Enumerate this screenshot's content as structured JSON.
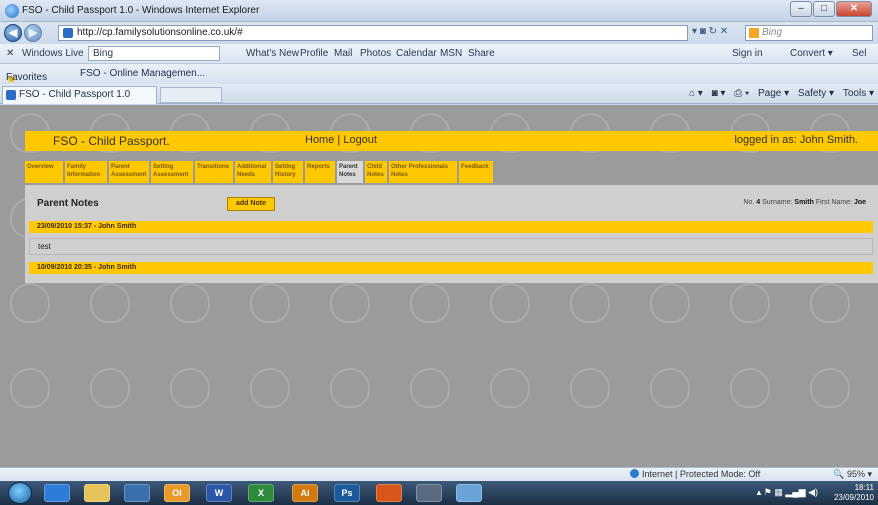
{
  "window": {
    "title": "FSO - Child Passport 1.0 - Windows Internet Explorer",
    "minimize": "–",
    "maximize": "□",
    "close": "✕"
  },
  "address": {
    "url": "http://cp.familysolutionsonline.co.uk/#",
    "search_placeholder": "Bing",
    "icons": "▾ ◙ ↻ ✕"
  },
  "live_toolbar": {
    "close": "✕",
    "brand": "Windows Live",
    "search_value": "Bing",
    "links": [
      "What's New",
      "Profile",
      "Mail",
      "Photos",
      "Calendar",
      "MSN",
      "Share"
    ],
    "sign_in": "Sign in",
    "convert": "Convert ▾",
    "select": "Sel"
  },
  "favorites": {
    "label": "Favorites",
    "item": "FSO - Online Managemen..."
  },
  "browser_tab": {
    "label": "FSO - Child Passport 1.0"
  },
  "command_bar": {
    "page": "Page ▾",
    "safety": "Safety ▾",
    "tools": "Tools ▾"
  },
  "app": {
    "brand": "FSO - Child Passport.",
    "home": "Home",
    "separator": "|",
    "logout": "Logout",
    "logged_in": "logged in as: John Smith.",
    "tabs": [
      {
        "label": "Overview"
      },
      {
        "label": "Family Information"
      },
      {
        "label": "Parent Assessment"
      },
      {
        "label": "Setting Assessment"
      },
      {
        "label": "Transitions"
      },
      {
        "label": "Additional Needs"
      },
      {
        "label": "Setting History"
      },
      {
        "label": "Reports"
      },
      {
        "label": "Parent Notes"
      },
      {
        "label": "Child Notes"
      },
      {
        "label": "Other Professionals Notes"
      },
      {
        "label": "Feedback"
      }
    ],
    "panel_title": "Parent Notes",
    "add_note": "add Note",
    "no_label": "No.",
    "no_value": "4",
    "surname_label": "Surname:",
    "surname_value": "Smith",
    "firstname_label": "First Name:",
    "firstname_value": "Joe",
    "notes": [
      {
        "header": "23/09/2010 15:37 - John Smith",
        "body": "test"
      },
      {
        "header": "10/09/2010 20:35 - John Smith",
        "body": ""
      }
    ]
  },
  "status": {
    "zone": "Internet | Protected Mode: Off",
    "zoom": "95%"
  },
  "taskbar": {
    "time": "18:11",
    "date": "23/09/2010",
    "apps": [
      "",
      "",
      "",
      "Ol",
      "W",
      "X",
      "Ai",
      "Ps",
      "",
      "",
      ""
    ]
  }
}
